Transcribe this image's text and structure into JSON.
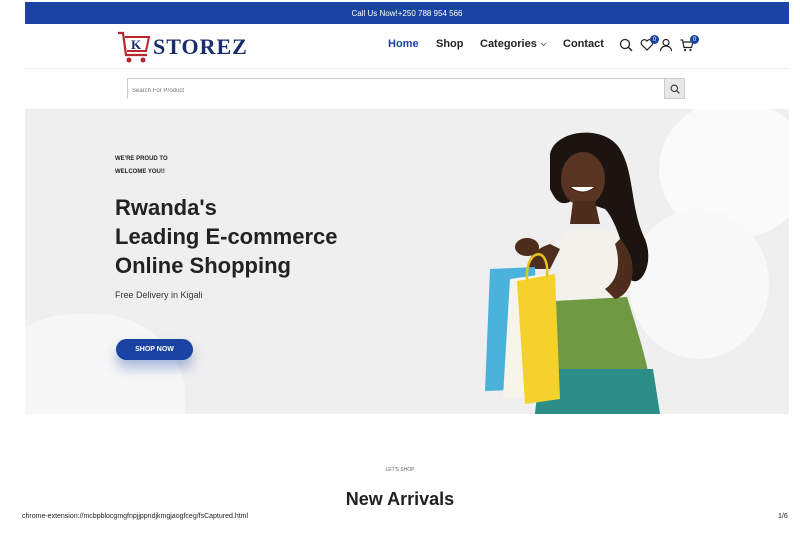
{
  "topbar": {
    "text": "Call Us Now!+250 788 954 566"
  },
  "brand": {
    "k_letter": "K",
    "name": "STOREZ"
  },
  "nav": {
    "home": "Home",
    "shop": "Shop",
    "categories": "Categories",
    "contact": "Contact"
  },
  "header_icons": {
    "search": "search-icon",
    "wishlist": "heart-icon",
    "wishlist_count": "0",
    "user": "user-icon",
    "cart": "cart-icon",
    "cart_count": "0"
  },
  "search": {
    "placeholder": "Search For Product"
  },
  "hero": {
    "proud_line1": "WE'RE PROUD TO",
    "proud_line2": "WELCOME YOU!!",
    "headline_line1": "Rwanda's",
    "headline_line2": "Leading E-commerce",
    "headline_line3": "Online Shopping",
    "subtitle": "Free Delivery in Kigali",
    "cta": "SHOP NOW"
  },
  "section": {
    "kicker": "LET'S SHOP",
    "title": "New Arrivals"
  },
  "print_footer": {
    "url": "chrome-extension://mcbpblocgmgfnpjjppndjkmgjaogfceg/fsCaptured.html",
    "page": "1/6"
  },
  "colors": {
    "accent": "#1a43a3",
    "brand_red": "#b5282e",
    "brand_navy": "#1a2c6b"
  }
}
